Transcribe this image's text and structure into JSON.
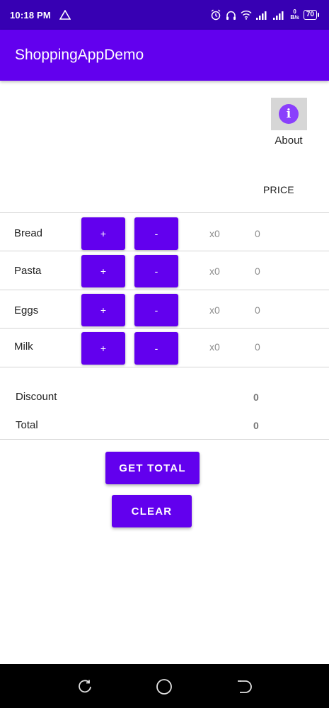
{
  "status_bar": {
    "time": "10:18 PM",
    "icons": [
      "warning-triangle-icon",
      "alarm-icon",
      "headphones-icon",
      "wifi-icon",
      "signal-icon",
      "signal-icon"
    ],
    "net_speed_value": "0",
    "net_speed_unit": "B/s",
    "battery": "70"
  },
  "app_bar": {
    "title": "ShoppingAppDemo"
  },
  "about": {
    "label": "About",
    "icon": "info-icon"
  },
  "table": {
    "price_header": "PRICE",
    "rows": [
      {
        "name": "Bread",
        "plus": "+",
        "minus": "-",
        "qty": "x0",
        "price": "0"
      },
      {
        "name": "Pasta",
        "plus": "+",
        "minus": "-",
        "qty": "x0",
        "price": "0"
      },
      {
        "name": "Eggs",
        "plus": "+",
        "minus": "-",
        "qty": "x0",
        "price": "0"
      },
      {
        "name": "Milk",
        "plus": "+",
        "minus": "-",
        "qty": "x0",
        "price": "0"
      }
    ]
  },
  "summary": {
    "discount_label": "Discount",
    "discount_value": "0",
    "total_label": "Total",
    "total_value": "0"
  },
  "actions": {
    "get_total": "GET TOTAL",
    "clear": "CLEAR"
  },
  "colors": {
    "primary": "#6200ee",
    "primary_dark": "#3700b3",
    "about_icon": "#8a3ffc"
  },
  "nav_bar": {
    "icons": [
      "recent-apps-icon",
      "home-icon",
      "back-icon"
    ]
  }
}
